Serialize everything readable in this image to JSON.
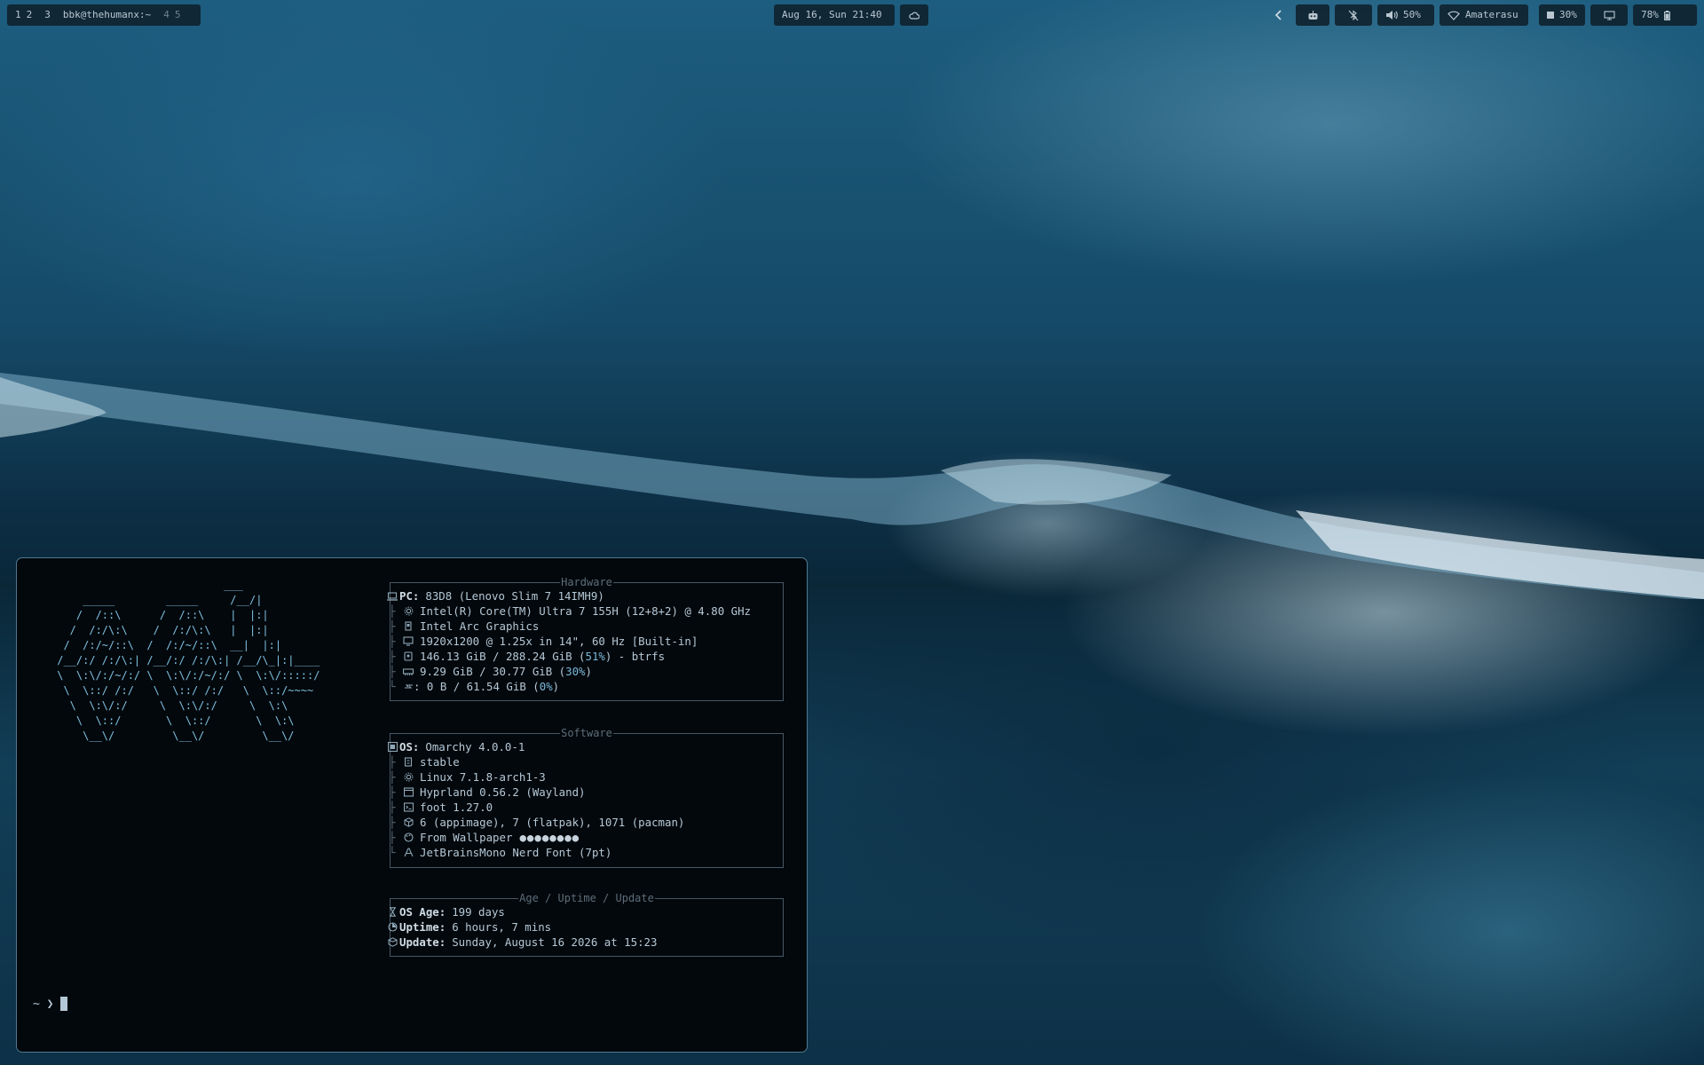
{
  "topbar": {
    "workspaces": [
      "1",
      "2",
      "3"
    ],
    "window_title": "bbk@thehumanx:~",
    "workspaces_dim": [
      "4",
      "5"
    ],
    "clock": "Aug 16, Sun 21:40",
    "weather_icon": "cloud-icon",
    "tray": {
      "collapse_icon": "chevron-left-icon",
      "bot_icon": "robot-icon",
      "bluetooth_icon": "bluetooth-off-icon",
      "volume_icon": "speaker-icon",
      "volume": "50%",
      "wifi_icon": "wifi-icon",
      "network": "Amaterasu",
      "cpu_icon": "cpu-chip-icon",
      "cpu": "30%",
      "monitor_icon": "monitor-icon",
      "battery": "78%",
      "battery_icon": "battery-icon"
    }
  },
  "terminal": {
    "ascii_logo": "                           ___\n     _____        _____     /__/|\n    /  /::\\      /  /::\\    |  |:|\n   /  /:/\\:\\    /  /:/\\:\\   |  |:|\n  /  /:/~/::\\  /  /:/~/::\\  __|  |:|\n /__/:/ /:/\\:| /__/:/ /:/\\:| /__/\\_|:|____\n \\  \\:\\/:/~/:/ \\  \\:\\/:/~/:/ \\  \\:\\/:::::/\n  \\  \\::/ /:/   \\  \\::/ /:/   \\  \\::/~~~~\n   \\  \\:\\/:/     \\  \\:\\/:/     \\  \\:\\\n    \\  \\::/       \\  \\::/       \\  \\:\\\n     \\__\\/         \\__\\/         \\__\\/",
    "hardware": {
      "title": "Hardware",
      "pc_key": "PC:",
      "pc": "83D8 (Lenovo Slim 7 14IMH9)",
      "cpu": "Intel(R) Core(TM) Ultra 7 155H (12+8+2) @ 4.80 GHz",
      "gpu": "Intel Arc Graphics",
      "display": "1920x1200 @ 1.25x in 14\", 60 Hz [Built-in]",
      "disk_used": "146.13 GiB / 288.24 GiB (",
      "disk_pct": "51%",
      "disk_fs": ") - btrfs",
      "mem_used": "9.29 GiB / 30.77 GiB (",
      "mem_pct": "30%",
      "mem_close": ")",
      "swap_used": ": 0 B / 61.54 GiB (",
      "swap_pct": "0%",
      "swap_close": ")"
    },
    "software": {
      "title": "Software",
      "os_key": "OS:",
      "os": "Omarchy 4.0.0-1",
      "channel_key": "󰀦:",
      "channel": "stable",
      "kernel": "Linux 7.1.8-arch1-3",
      "wm": "Hyprland 0.56.2 (Wayland)",
      "terminal": "foot 1.27.0",
      "packages": "6 (appimage), 7 (flatpak), 1071 (pacman)",
      "theme": "From Wallpaper",
      "palette_dots": "●●●●●●●●",
      "font": "JetBrainsMono Nerd Font (7pt)"
    },
    "age": {
      "title": "Age / Uptime / Update",
      "os_age_key": "OS Age:",
      "os_age": "199 days",
      "uptime_key": "Uptime:",
      "uptime": "6 hours, 7 mins",
      "update_key": "Update:",
      "update": "Sunday, August 16 2026 at 15:23"
    },
    "prompt": "~ ❯"
  }
}
